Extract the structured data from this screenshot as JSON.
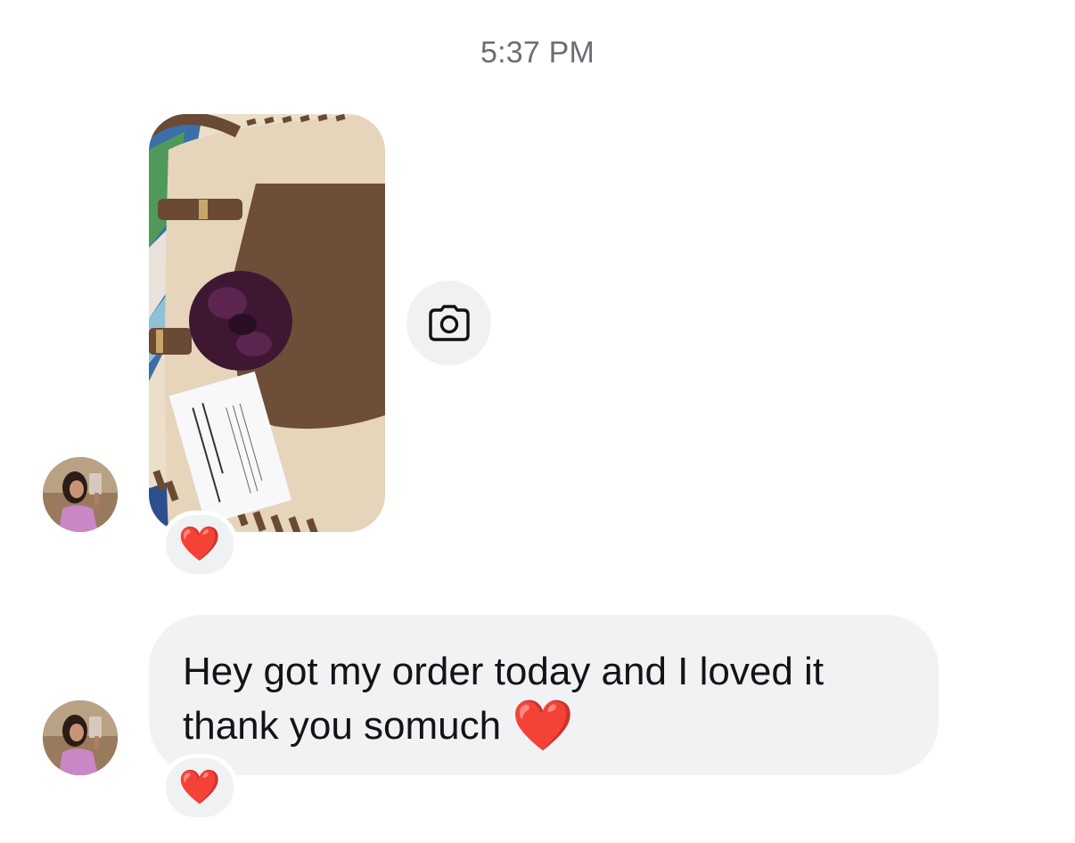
{
  "conversation": {
    "timestamp": "5:37 PM",
    "messages": [
      {
        "type": "photo",
        "description_icon": "photo-attachment",
        "reaction": "❤️",
        "share_action_icon": "camera-icon"
      },
      {
        "type": "text",
        "text": "Hey got my order today and I loved it thank you somuch",
        "trailing_emoji": "❤️",
        "reaction": "❤️"
      }
    ]
  },
  "colors": {
    "bubble_background": "#f1f2f4",
    "timestamp_text": "#6b6f75",
    "message_text": "#121417",
    "reaction_heart": "#e0202d"
  }
}
